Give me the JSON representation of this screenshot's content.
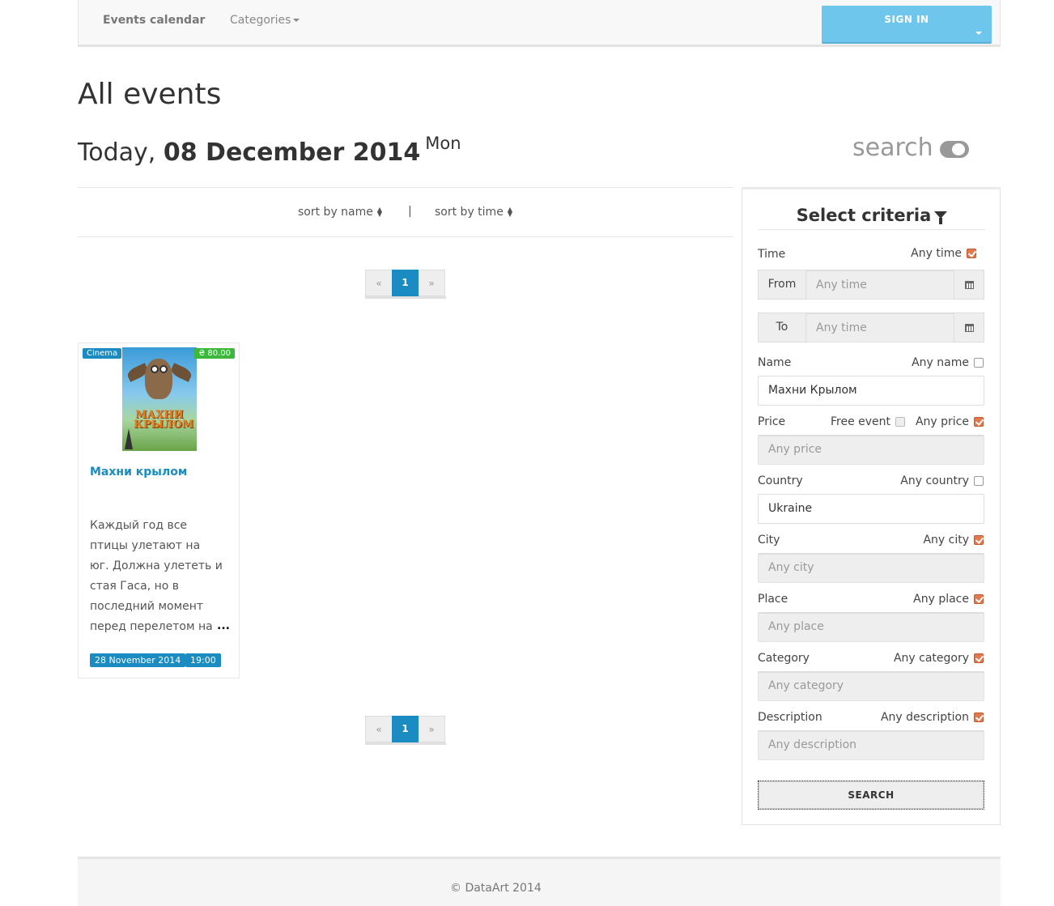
{
  "navbar": {
    "brand": "Events calendar",
    "categories": "Categories",
    "signin": "SIGN IN"
  },
  "header": {
    "title": "All events",
    "today_prefix": "Today,",
    "date": "08 December 2014",
    "weekday": "Mon",
    "search_toggle": "search"
  },
  "sort": {
    "by_name": "sort by name",
    "separator": "|",
    "by_time": "sort by time"
  },
  "pagination": {
    "prev": "«",
    "current": "1",
    "next": "»"
  },
  "event": {
    "category": "Cinema",
    "price": "₴ 80.00",
    "title": "Махни крылом",
    "poster_text": "МАХНИ КРЫЛОМ",
    "description": "Каждый год все птицы улетают на юг. Должна улететь и стая Гаса, но в последний момент перед перелетом на",
    "ellipsis": "...",
    "date": "28 November 2014",
    "time": "19:00"
  },
  "filter": {
    "title": "Select criteria",
    "time": {
      "label": "Time",
      "any": "Any time",
      "any_checked": true,
      "from_label": "From",
      "from_placeholder": "Any time",
      "to_label": "To",
      "to_placeholder": "Any time"
    },
    "name": {
      "label": "Name",
      "any": "Any name",
      "any_checked": false,
      "value": "Махни Крылом"
    },
    "price": {
      "label": "Price",
      "free": "Free event",
      "any": "Any price",
      "any_checked": true,
      "placeholder": "Any price"
    },
    "country": {
      "label": "Country",
      "any": "Any country",
      "any_checked": false,
      "value": "Ukraine"
    },
    "city": {
      "label": "City",
      "any": "Any city",
      "any_checked": true,
      "placeholder": "Any city"
    },
    "place": {
      "label": "Place",
      "any": "Any place",
      "any_checked": true,
      "placeholder": "Any place"
    },
    "category": {
      "label": "Category",
      "any": "Any category",
      "any_checked": true,
      "placeholder": "Any category"
    },
    "description": {
      "label": "Description",
      "any": "Any description",
      "any_checked": true,
      "placeholder": "Any description"
    },
    "search_button": "SEARCH"
  },
  "footer": {
    "copyright": "© DataArt 2014"
  },
  "colors": {
    "primary": "#1a8cc1",
    "signin": "#6ec6ec",
    "price_badge": "#3cb83c",
    "checkbox_checked": "#e2784d"
  }
}
